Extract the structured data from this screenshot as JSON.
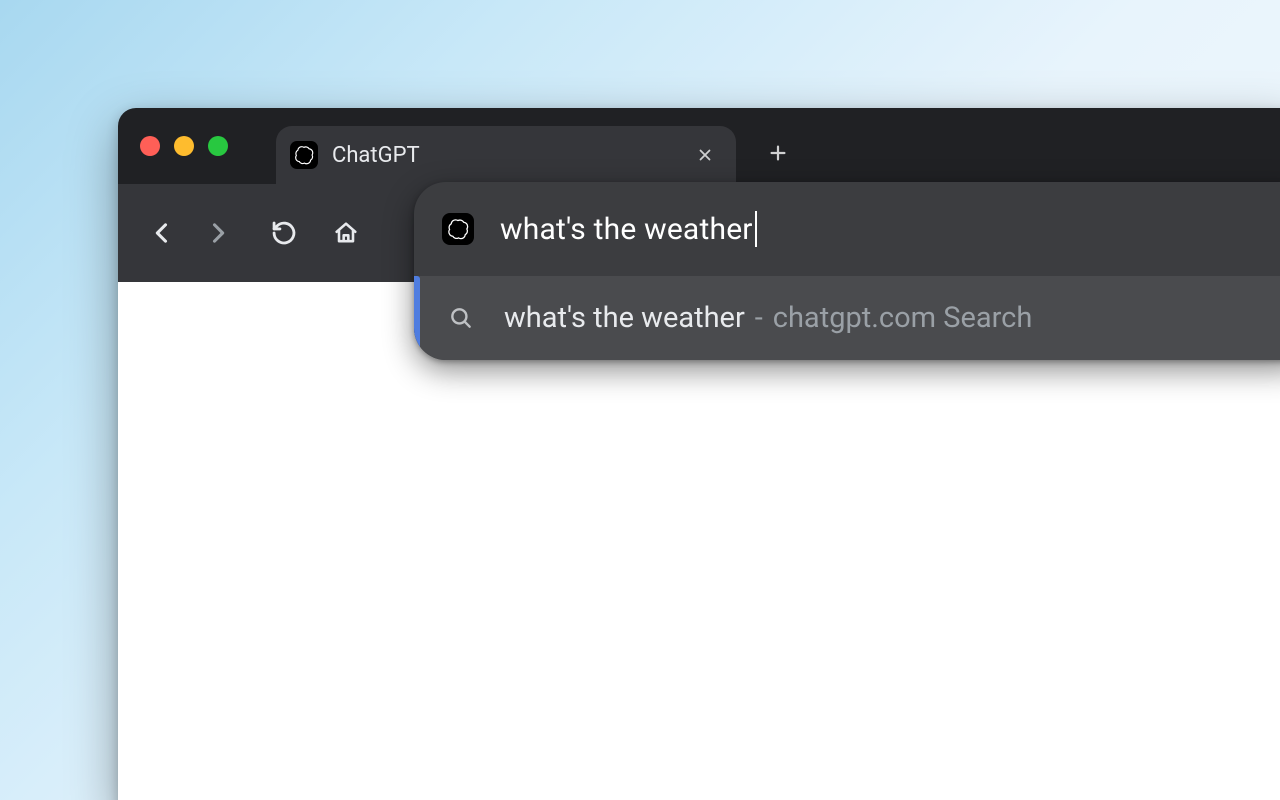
{
  "tab": {
    "title": "ChatGPT",
    "favicon": "chatgpt-icon"
  },
  "omnibox": {
    "input_value": "what's the weather",
    "site_icon": "chatgpt-icon",
    "suggestion": {
      "query": "what's the weather",
      "separator": " - ",
      "source": "chatgpt.com Search"
    }
  }
}
